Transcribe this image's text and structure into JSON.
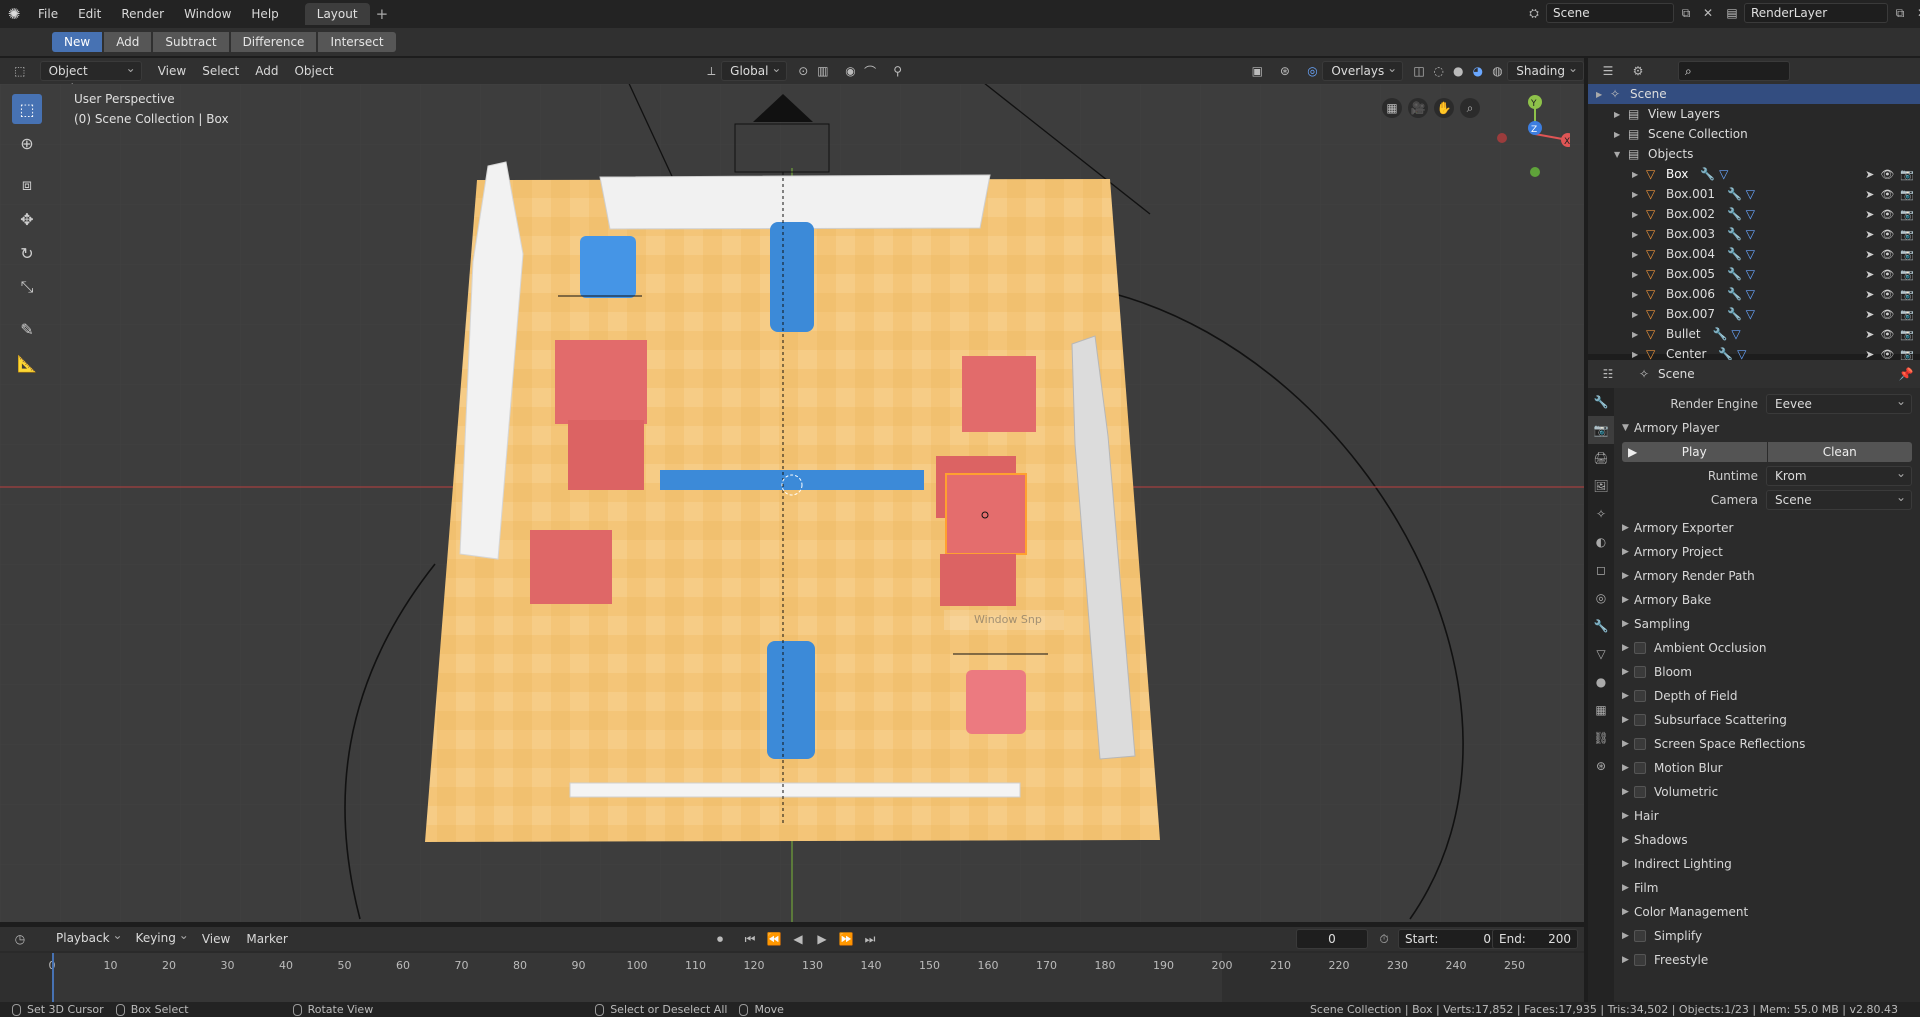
{
  "menu": {
    "items": [
      "File",
      "Edit",
      "Render",
      "Window",
      "Help"
    ],
    "workspace_tab": "Layout",
    "scene_field": "Scene",
    "layer_field": "RenderLayer"
  },
  "boolean_toolbar": {
    "new": "New",
    "add": "Add",
    "subtract": "Subtract",
    "difference": "Difference",
    "intersect": "Intersect"
  },
  "viewport_header": {
    "mode": "Object Mode",
    "menus": [
      "View",
      "Select",
      "Add",
      "Object"
    ],
    "orientation": "Global",
    "overlays": "Overlays",
    "shading": "Shading"
  },
  "viewport": {
    "perspective_label": "User Perspective",
    "collection_label": "(0) Scene Collection | Box",
    "snap_popup": "Window Snp"
  },
  "gizmo": {
    "x": "X",
    "y": "Y",
    "z": "Z"
  },
  "outliner": {
    "rows": [
      {
        "label": "Scene",
        "depth": 0,
        "selected": true
      },
      {
        "label": "View Layers",
        "depth": 1
      },
      {
        "label": "Scene Collection",
        "depth": 1
      },
      {
        "label": "Objects",
        "depth": 1,
        "open": true
      },
      {
        "label": "Box",
        "depth": 2,
        "bright": true
      },
      {
        "label": "Box.001",
        "depth": 2
      },
      {
        "label": "Box.002",
        "depth": 2
      },
      {
        "label": "Box.003",
        "depth": 2
      },
      {
        "label": "Box.004",
        "depth": 2
      },
      {
        "label": "Box.005",
        "depth": 2
      },
      {
        "label": "Box.006",
        "depth": 2
      },
      {
        "label": "Box.007",
        "depth": 2
      },
      {
        "label": "Bullet",
        "depth": 2
      },
      {
        "label": "Center",
        "depth": 2
      }
    ]
  },
  "properties": {
    "context": "Scene",
    "render_engine_label": "Render Engine",
    "render_engine_value": "Eevee",
    "armory_player": "Armory Player",
    "play": "Play",
    "clean": "Clean",
    "runtime_label": "Runtime",
    "runtime_value": "Krom",
    "camera_label": "Camera",
    "camera_value": "Scene",
    "panels": [
      {
        "label": "Armory Exporter",
        "check": false
      },
      {
        "label": "Armory Project",
        "check": false
      },
      {
        "label": "Armory Render Path",
        "check": false
      },
      {
        "label": "Armory Bake",
        "check": false
      },
      {
        "label": "Sampling",
        "check": false
      },
      {
        "label": "Ambient Occlusion",
        "check": true
      },
      {
        "label": "Bloom",
        "check": true
      },
      {
        "label": "Depth of Field",
        "check": true
      },
      {
        "label": "Subsurface Scattering",
        "check": true
      },
      {
        "label": "Screen Space Reflections",
        "check": true
      },
      {
        "label": "Motion Blur",
        "check": true
      },
      {
        "label": "Volumetric",
        "check": true
      },
      {
        "label": "Hair",
        "check": false
      },
      {
        "label": "Shadows",
        "check": false
      },
      {
        "label": "Indirect Lighting",
        "check": false
      },
      {
        "label": "Film",
        "check": false
      },
      {
        "label": "Color Management",
        "check": false
      },
      {
        "label": "Simplify",
        "check": true
      },
      {
        "label": "Freestyle",
        "check": true
      }
    ]
  },
  "timeline": {
    "menus": [
      "Playback",
      "Keying",
      "View",
      "Marker"
    ],
    "current_frame": "0",
    "start_label": "Start:",
    "start_value": "0",
    "end_label": "End:",
    "end_value": "200",
    "ticks": [
      "0",
      "10",
      "20",
      "30",
      "40",
      "50",
      "60",
      "70",
      "80",
      "90",
      "100",
      "110",
      "120",
      "130",
      "140",
      "150",
      "160",
      "170",
      "180",
      "190",
      "200",
      "210",
      "220",
      "230",
      "240",
      "250"
    ],
    "playhead_frame": 0,
    "range_end_frame": 200
  },
  "statusbar": {
    "set_cursor": "Set 3D Cursor",
    "box_select": "Box Select",
    "rotate_view": "Rotate View",
    "select_deselect": "Select or Deselect All",
    "move": "Move",
    "stats": "Scene Collection | Box | Verts:17,852 | Faces:17,935 | Tris:34,502 | Objects:1/23 | Mem: 55.0 MB | v2.80.43"
  },
  "colors": {
    "accent": "#4772b3",
    "floor": "#f4c578",
    "blue_object": "#3c8ad8",
    "red_object": "#e26b6b",
    "selection": "#ffa030"
  }
}
